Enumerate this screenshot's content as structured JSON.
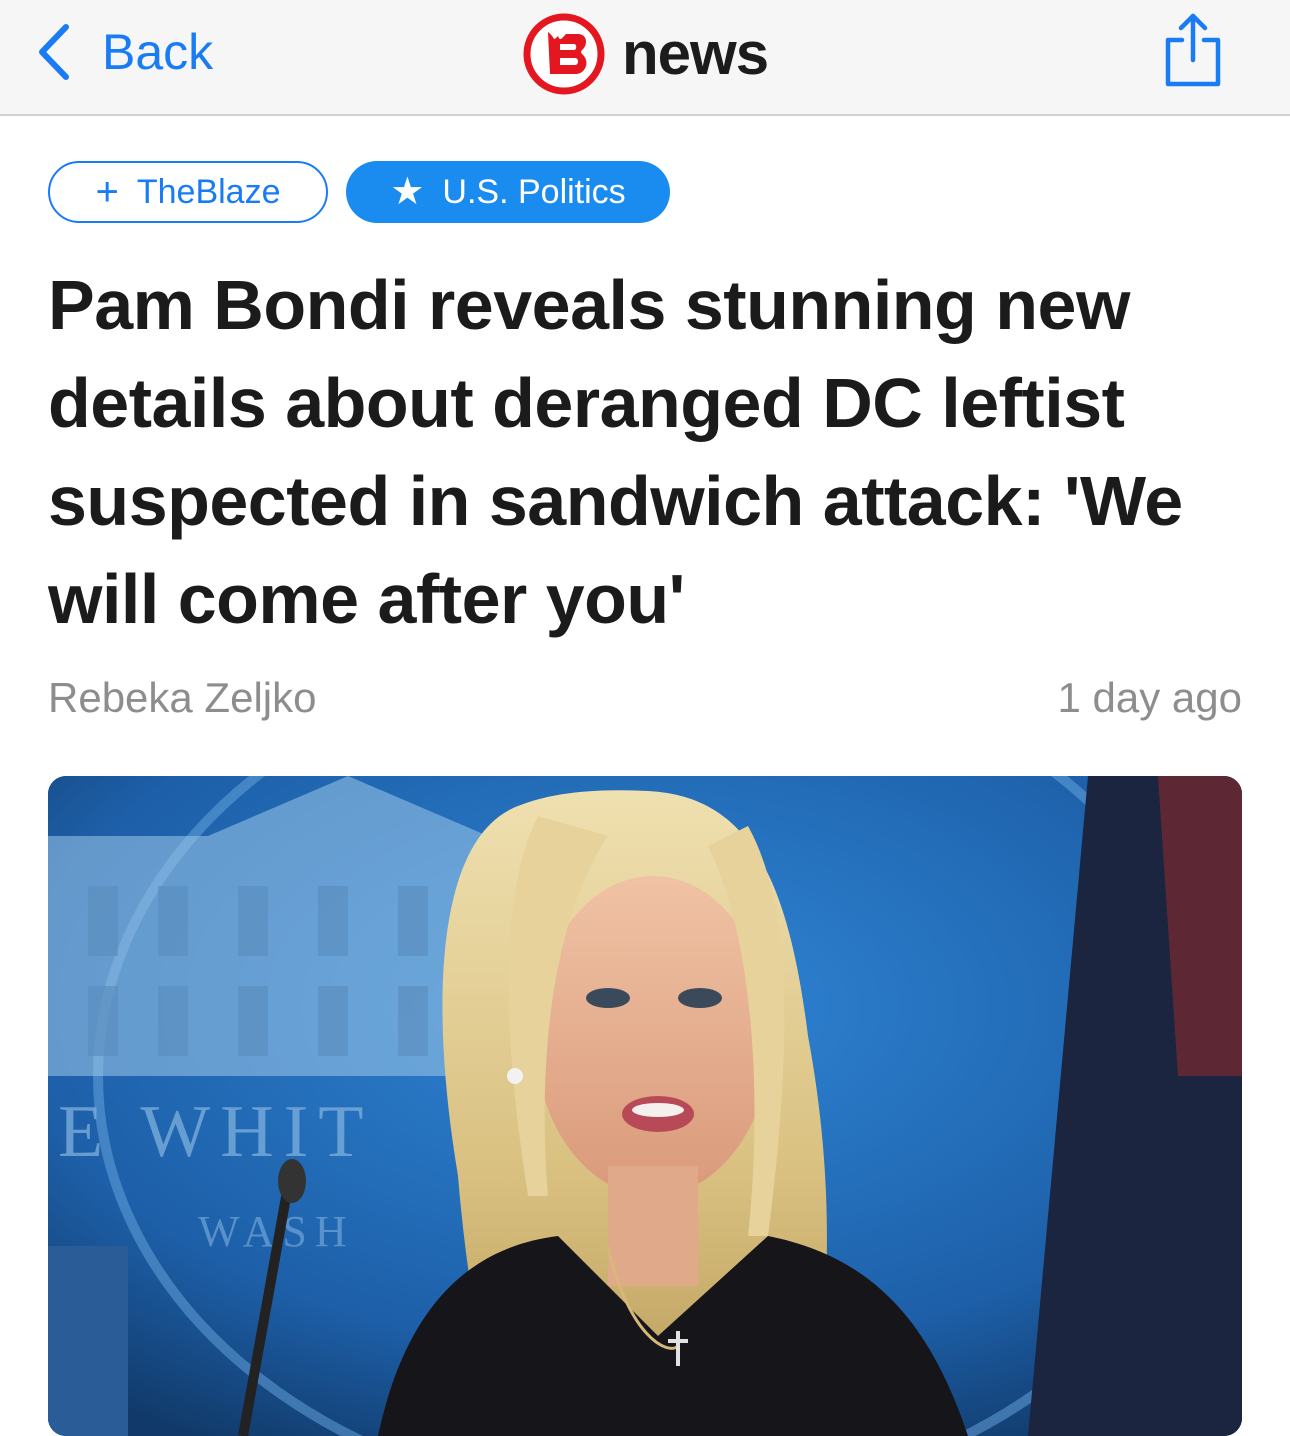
{
  "nav": {
    "back_label": "Back",
    "brand_text": "news",
    "brand_color": "#e4161f",
    "accent_color": "#1a7cf5"
  },
  "tags": [
    {
      "icon": "plus-icon",
      "label": "TheBlaze",
      "style": "outline"
    },
    {
      "icon": "star-icon",
      "label": "U.S. Politics",
      "style": "filled"
    }
  ],
  "article": {
    "headline": "Pam Bondi reveals stunning new details about deranged DC leftist suspected in sandwich attack: 'We will come after you'",
    "author": "Rebeka Zeljko",
    "time_ago": "1 day ago",
    "image_text": "THE WHITE HOUSE WASHINGTON"
  }
}
